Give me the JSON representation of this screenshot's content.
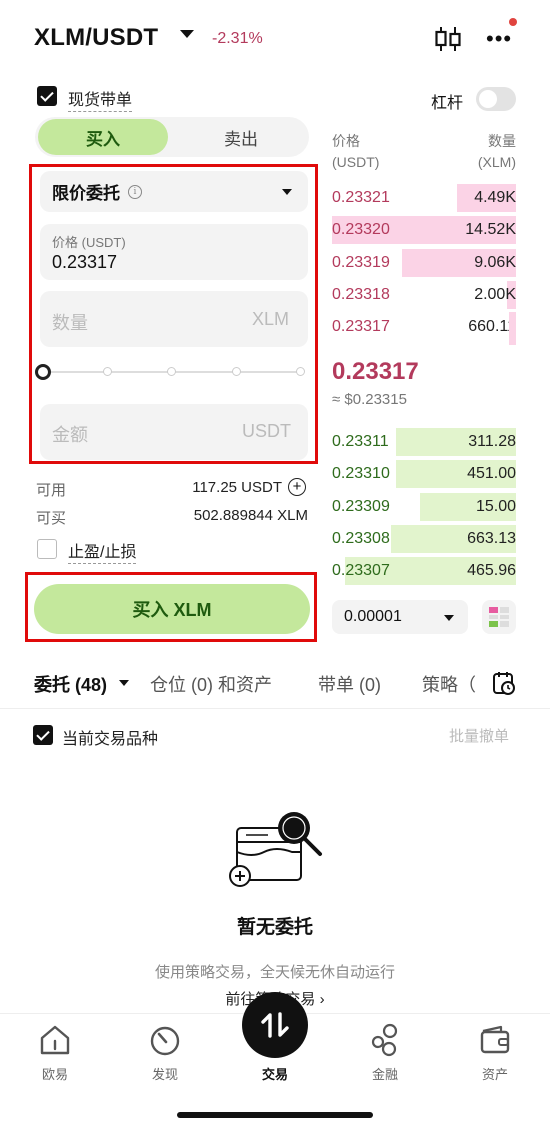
{
  "header": {
    "pair": "XLM/USDT",
    "change": "-2.31%"
  },
  "spot_copy": {
    "label": "现货带单",
    "checked": true
  },
  "leverage": {
    "label": "杠杆",
    "on": false
  },
  "side_tabs": {
    "buy": "买入",
    "sell": "卖出",
    "active": "buy"
  },
  "order_form": {
    "order_type": "限价委托",
    "price_label": "价格 (USDT)",
    "price_value": "0.23317",
    "qty_placeholder": "数量",
    "qty_unit": "XLM",
    "slider_percent": 0,
    "amount_placeholder": "金额",
    "amount_unit": "USDT"
  },
  "balances": {
    "available_label": "可用",
    "available_value": "117.25 USDT",
    "buyable_label": "可买",
    "buyable_value": "502.889844 XLM"
  },
  "tpsl": {
    "label": "止盈/止损",
    "checked": false
  },
  "buy_button": "买入 XLM",
  "order_book": {
    "price_header_1": "价格",
    "price_header_2": "(USDT)",
    "qty_header_1": "数量",
    "qty_header_2": "(XLM)",
    "asks": [
      {
        "price": "0.23321",
        "qty": "4.49K",
        "depth": 0.32
      },
      {
        "price": "0.23320",
        "qty": "14.52K",
        "depth": 1.0
      },
      {
        "price": "0.23319",
        "qty": "9.06K",
        "depth": 0.62
      },
      {
        "price": "0.23318",
        "qty": "2.00K",
        "depth": 0.05
      },
      {
        "price": "0.23317",
        "qty": "660.11",
        "depth": 0.04
      }
    ],
    "mid_price": "0.23317",
    "mid_usd": "≈ $0.23315",
    "bids": [
      {
        "price": "0.23311",
        "qty": "311.28",
        "depth": 0.65
      },
      {
        "price": "0.23310",
        "qty": "451.00",
        "depth": 0.65
      },
      {
        "price": "0.23309",
        "qty": "15.00",
        "depth": 0.52
      },
      {
        "price": "0.23308",
        "qty": "663.13",
        "depth": 0.68
      },
      {
        "price": "0.23307",
        "qty": "465.96",
        "depth": 0.93
      }
    ],
    "precision": "0.00001"
  },
  "lower_tabs": [
    {
      "label": "委托 (48)",
      "active": true
    },
    {
      "label": "仓位 (0) 和资产",
      "active": false
    },
    {
      "label": "带单 (0)",
      "active": false
    },
    {
      "label": "策略（",
      "active": false
    }
  ],
  "filter": {
    "current_pair_label": "当前交易品种",
    "checked": true,
    "bulk_cancel": "批量撤单"
  },
  "empty_state": {
    "title": "暂无委托",
    "subtitle": "使用策略交易，全天候无休自动运行",
    "link": "前往策略交易 ›"
  },
  "bottom_nav": [
    {
      "label": "欧易",
      "icon": "home-icon"
    },
    {
      "label": "发现",
      "icon": "discover-icon"
    },
    {
      "label": "交易",
      "icon": "trade-icon"
    },
    {
      "label": "金融",
      "icon": "finance-icon"
    },
    {
      "label": "资产",
      "icon": "wallet-icon"
    }
  ],
  "colors": {
    "buy_green": "#c4e89c",
    "buy_text": "#1f5b0f",
    "ask_red": "#b33a5c",
    "ask_bar": "#fbd3e6",
    "bid_green": "#2e6b1c",
    "bid_bar": "#e2f4cd",
    "highlight_box": "#e00a0a"
  }
}
